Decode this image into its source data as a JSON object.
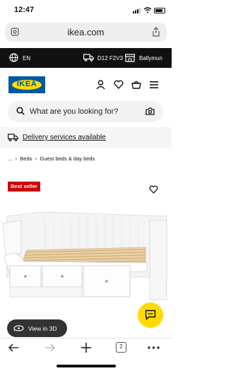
{
  "status_bar": {
    "time": "12:47"
  },
  "browser": {
    "url": "ikea.com",
    "tab_count": "2"
  },
  "top_strip": {
    "language": "EN",
    "postcode": "D12 F2V3",
    "store": "Ballymun"
  },
  "header": {
    "logo_text": "IKEA"
  },
  "search": {
    "placeholder": "What are you looking for?"
  },
  "delivery": {
    "label": "Delivery services available"
  },
  "breadcrumb": {
    "ellipsis": "...",
    "items": [
      "Beds",
      "Guest beds & day beds"
    ]
  },
  "product": {
    "badge": "Best seller",
    "view_3d_label": "View in 3D"
  },
  "colors": {
    "ikea_blue": "#0058a3",
    "ikea_yellow": "#ffdb00",
    "badge_red": "#cc0008",
    "top_strip_bg": "#111111"
  },
  "icons": [
    "tune-icon",
    "share-icon",
    "globe-icon",
    "truck-icon",
    "store-icon",
    "user-icon",
    "heart-icon",
    "basket-icon",
    "menu-icon",
    "search-icon",
    "camera-icon",
    "chat-icon",
    "3d-icon",
    "back-icon",
    "forward-icon",
    "plus-icon",
    "more-icon"
  ]
}
